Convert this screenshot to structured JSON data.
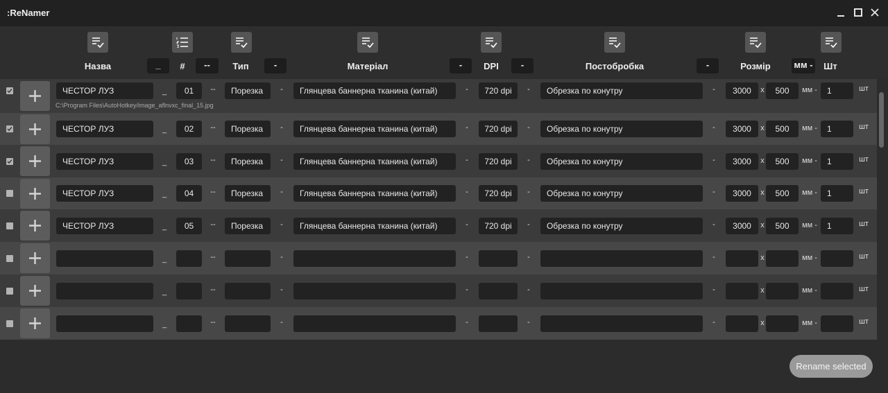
{
  "app": {
    "title": ":ReNamer"
  },
  "window_controls": [
    "minimize-icon",
    "maximize-icon",
    "close-icon"
  ],
  "header": {
    "name_label": "Назва",
    "num_label": "#",
    "type_label": "Тип",
    "material_label": "Матеріал",
    "dpi_label": "DPI",
    "post_label": "Постобробка",
    "size_label": "Розмір",
    "qty_label": "Шт",
    "sep_name": "_",
    "sep_num": "--",
    "sep_type": "-",
    "sep_material": "-",
    "sep_dpi": "-",
    "sep_post": "-",
    "size_unit_sep": "мм -",
    "list_icon": "list-check-icon",
    "numbered_icon": "numbered-list-icon"
  },
  "row_labels": {
    "sep_name": "_",
    "sep_num": "--",
    "sep_dash": "-",
    "times": "x",
    "unit": "мм -",
    "qty_unit": "шт",
    "add_icon": "plus-icon"
  },
  "rows": [
    {
      "checked": true,
      "name": "ЧЕСТОР ЛУЗ",
      "num": "01",
      "type": "Порезка",
      "material": "Глянцева баннерна тканина (китай)",
      "dpi": "720 dpi",
      "post": "Обрезка по конутру",
      "width": "3000",
      "height": "500",
      "qty": "1",
      "path": "C:\\Program Files\\AutoHotkey/image_aflnvxc_final_15.jpg"
    },
    {
      "checked": true,
      "name": "ЧЕСТОР ЛУЗ",
      "num": "02",
      "type": "Порезка",
      "material": "Глянцева баннерна тканина (китай)",
      "dpi": "720 dpi",
      "post": "Обрезка по конутру",
      "width": "3000",
      "height": "500",
      "qty": "1",
      "path": ""
    },
    {
      "checked": true,
      "name": "ЧЕСТОР ЛУЗ",
      "num": "03",
      "type": "Порезка",
      "material": "Глянцева баннерна тканина (китай)",
      "dpi": "720 dpi",
      "post": "Обрезка по конутру",
      "width": "3000",
      "height": "500",
      "qty": "1",
      "path": ""
    },
    {
      "checked": false,
      "name": "ЧЕСТОР ЛУЗ",
      "num": "04",
      "type": "Порезка",
      "material": "Глянцева баннерна тканина (китай)",
      "dpi": "720 dpi",
      "post": "Обрезка по конутру",
      "width": "3000",
      "height": "500",
      "qty": "1",
      "path": ""
    },
    {
      "checked": false,
      "name": "ЧЕСТОР ЛУЗ",
      "num": "05",
      "type": "Порезка",
      "material": "Глянцева баннерна тканина (китай)",
      "dpi": "720 dpi",
      "post": "Обрезка по конутру",
      "width": "3000",
      "height": "500",
      "qty": "1",
      "path": ""
    },
    {
      "checked": false,
      "name": "",
      "num": "",
      "type": "",
      "material": "",
      "dpi": "",
      "post": "",
      "width": "",
      "height": "",
      "qty": "",
      "path": ""
    },
    {
      "checked": false,
      "name": "",
      "num": "",
      "type": "",
      "material": "",
      "dpi": "",
      "post": "",
      "width": "",
      "height": "",
      "qty": "",
      "path": ""
    },
    {
      "checked": false,
      "name": "",
      "num": "",
      "type": "",
      "material": "",
      "dpi": "",
      "post": "",
      "width": "",
      "height": "",
      "qty": "",
      "path": ""
    }
  ],
  "footer": {
    "rename_label": "Rename selected"
  }
}
